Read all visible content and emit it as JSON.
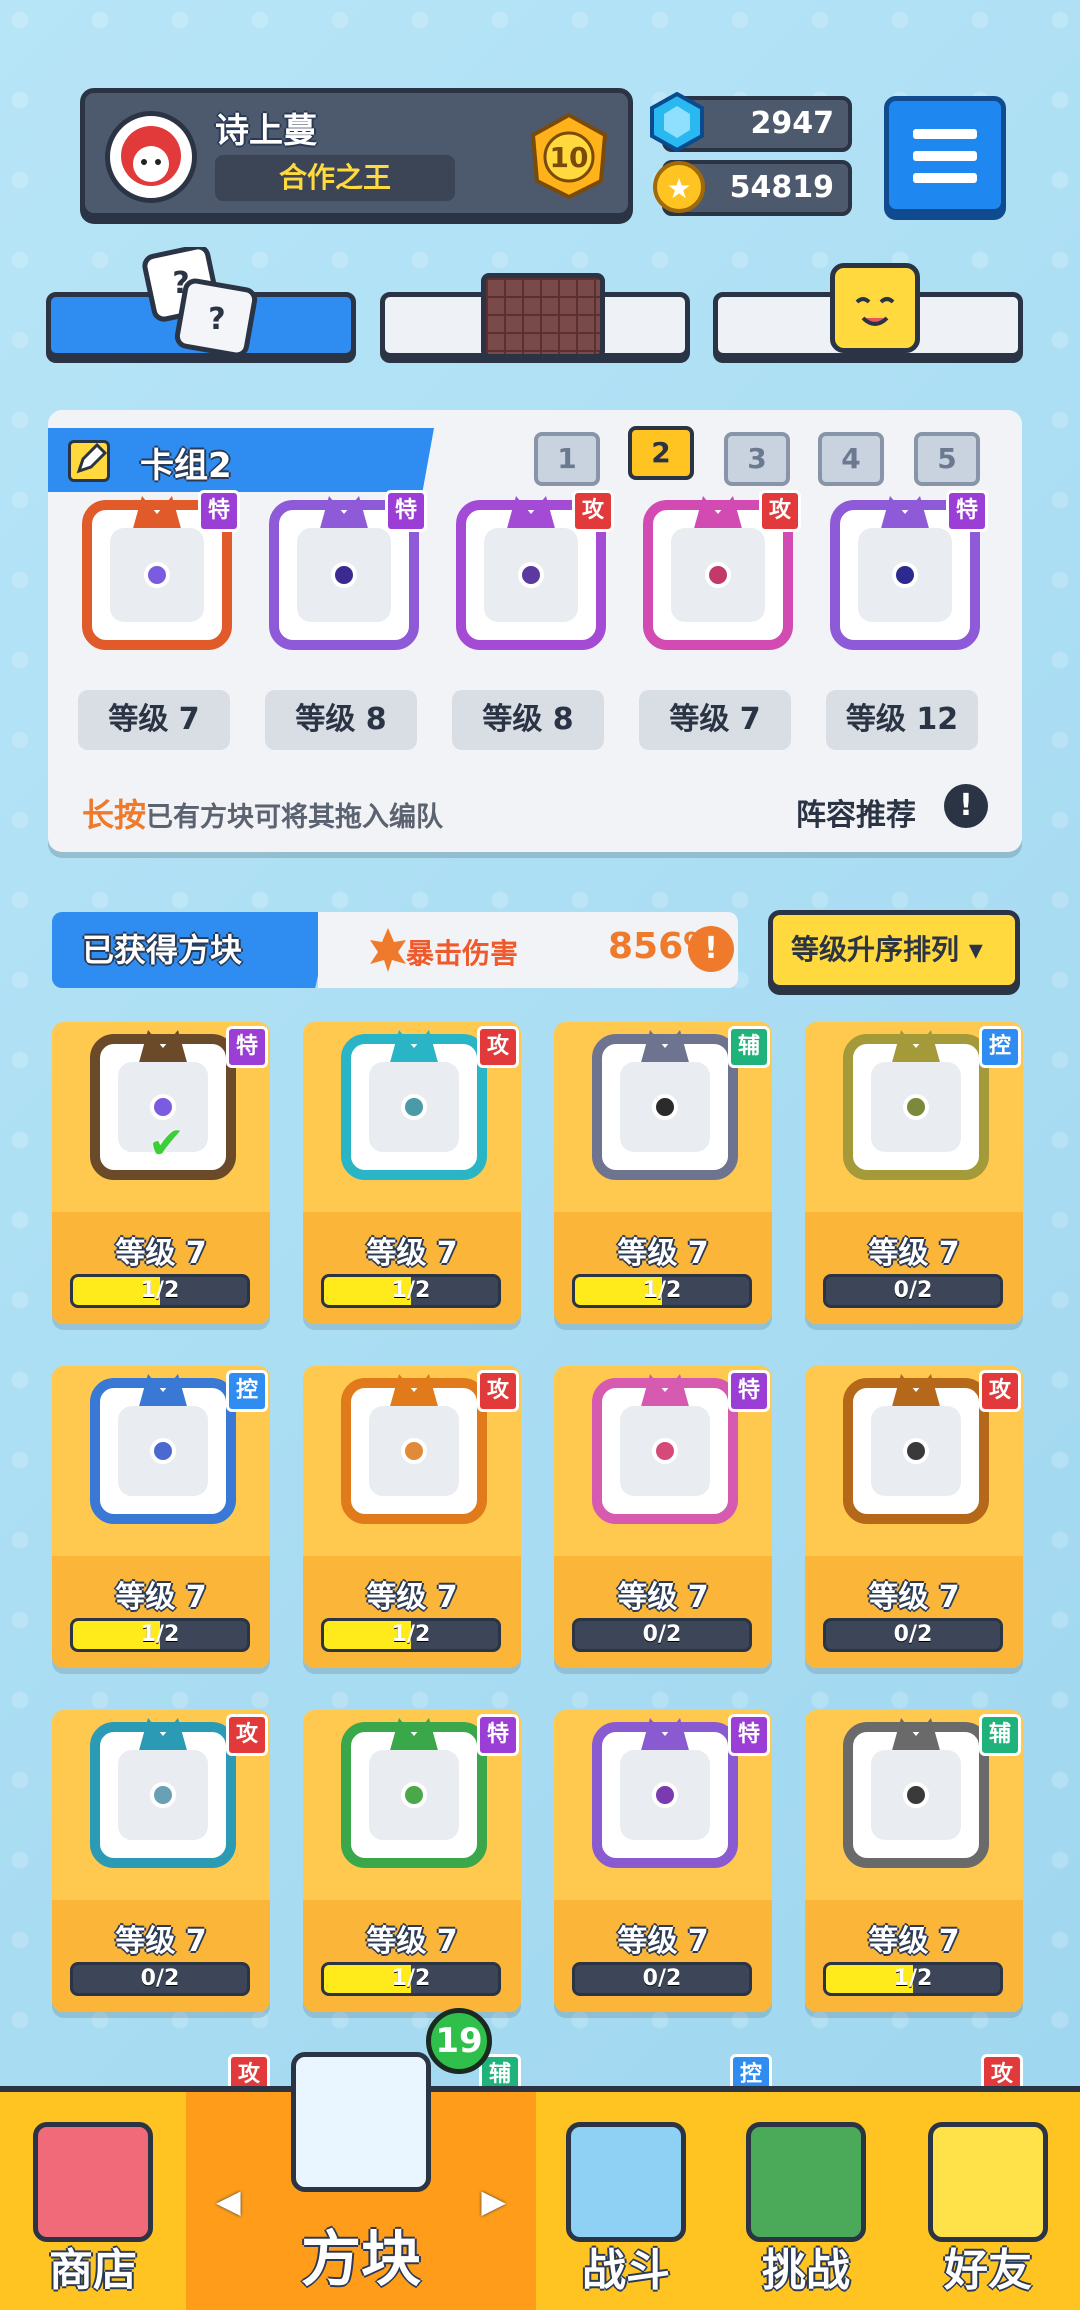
{
  "player": {
    "name": "诗上蔓",
    "title": "合作之王",
    "rank": "10"
  },
  "currency": {
    "gems": "2947",
    "coins": "54819"
  },
  "deck": {
    "label": "卡组2",
    "numbers": [
      "1",
      "2",
      "3",
      "4",
      "5"
    ],
    "active": "2",
    "cards": [
      {
        "tag": "特",
        "tag_type": "special",
        "level": "等级 7",
        "color": "#e05a2a",
        "pip": "#7b5ce0"
      },
      {
        "tag": "特",
        "tag_type": "special",
        "level": "等级 8",
        "color": "#8f5ad8",
        "pip": "#3b2a8f"
      },
      {
        "tag": "攻",
        "tag_type": "attack",
        "level": "等级 8",
        "color": "#a44bd6",
        "pip": "#5a3aa0"
      },
      {
        "tag": "攻",
        "tag_type": "attack",
        "level": "等级 7",
        "color": "#d14bb3",
        "pip": "#c23a6a"
      },
      {
        "tag": "特",
        "tag_type": "special",
        "level": "等级 12",
        "color": "#8f5ad8",
        "pip": "#2b2a8f"
      }
    ],
    "hint_prefix": "长按",
    "hint_rest": "已有方块可将其拖入编队",
    "recommend": "阵容推荐",
    "info": "!"
  },
  "owned": {
    "label": "已获得方块",
    "crit_label": "暴击伤害",
    "crit_value": "856%",
    "info": "!",
    "sort": "等级升序排列 ▾"
  },
  "grid": [
    {
      "tag": "特",
      "tag_type": "special",
      "level": "等级 7",
      "progress": "1/2",
      "fill": 0.5,
      "color": "#6b4a2a",
      "pip": "#7b5ce0",
      "check": "✔"
    },
    {
      "tag": "攻",
      "tag_type": "attack",
      "level": "等级 7",
      "progress": "1/2",
      "fill": 0.5,
      "color": "#2ab5c7",
      "pip": "#4a9aa8"
    },
    {
      "tag": "辅",
      "tag_type": "support",
      "level": "等级 7",
      "progress": "1/2",
      "fill": 0.5,
      "color": "#6e7390",
      "pip": "#2b2b2b"
    },
    {
      "tag": "控",
      "tag_type": "control",
      "level": "等级 7",
      "progress": "0/2",
      "fill": 0,
      "color": "#a59a3a",
      "pip": "#7b8a3a"
    },
    {
      "tag": "控",
      "tag_type": "control",
      "level": "等级 7",
      "progress": "1/2",
      "fill": 0.5,
      "color": "#3a78d6",
      "pip": "#4a6ad0"
    },
    {
      "tag": "攻",
      "tag_type": "attack",
      "level": "等级 7",
      "progress": "1/2",
      "fill": 0.5,
      "color": "#e07a1a",
      "pip": "#e08a3a"
    },
    {
      "tag": "特",
      "tag_type": "special",
      "level": "等级 7",
      "progress": "0/2",
      "fill": 0,
      "color": "#d65ab0",
      "pip": "#d64a7a"
    },
    {
      "tag": "攻",
      "tag_type": "attack",
      "level": "等级 7",
      "progress": "0/2",
      "fill": 0,
      "color": "#b5681a",
      "pip": "#3a3a3a"
    },
    {
      "tag": "攻",
      "tag_type": "attack",
      "level": "等级 7",
      "progress": "0/2",
      "fill": 0,
      "color": "#2a9ab5",
      "pip": "#6aa0b5"
    },
    {
      "tag": "特",
      "tag_type": "special",
      "level": "等级 7",
      "progress": "1/2",
      "fill": 0.5,
      "color": "#3aa84a",
      "pip": "#4aa84a"
    },
    {
      "tag": "特",
      "tag_type": "special",
      "level": "等级 7",
      "progress": "0/2",
      "fill": 0,
      "color": "#8a5ad0",
      "pip": "#7a3ab0"
    },
    {
      "tag": "辅",
      "tag_type": "support",
      "level": "等级 7",
      "progress": "1/2",
      "fill": 0.5,
      "color": "#6a6a6a",
      "pip": "#3a3a3a"
    }
  ],
  "peek_tags": [
    {
      "tag": "攻",
      "tag_type": "attack"
    },
    {
      "tag": "辅",
      "tag_type": "support"
    },
    {
      "tag": "控",
      "tag_type": "control"
    },
    {
      "tag": "攻",
      "tag_type": "attack"
    }
  ],
  "nav": {
    "shop": "商店",
    "blocks": "方块",
    "battle": "战斗",
    "challenge": "挑战",
    "friends": "好友",
    "badge": "19",
    "left_arrow": "◀",
    "right_arrow": "▶"
  },
  "colors": {
    "accent": "#2f8cf0",
    "gold": "#ffc421"
  }
}
